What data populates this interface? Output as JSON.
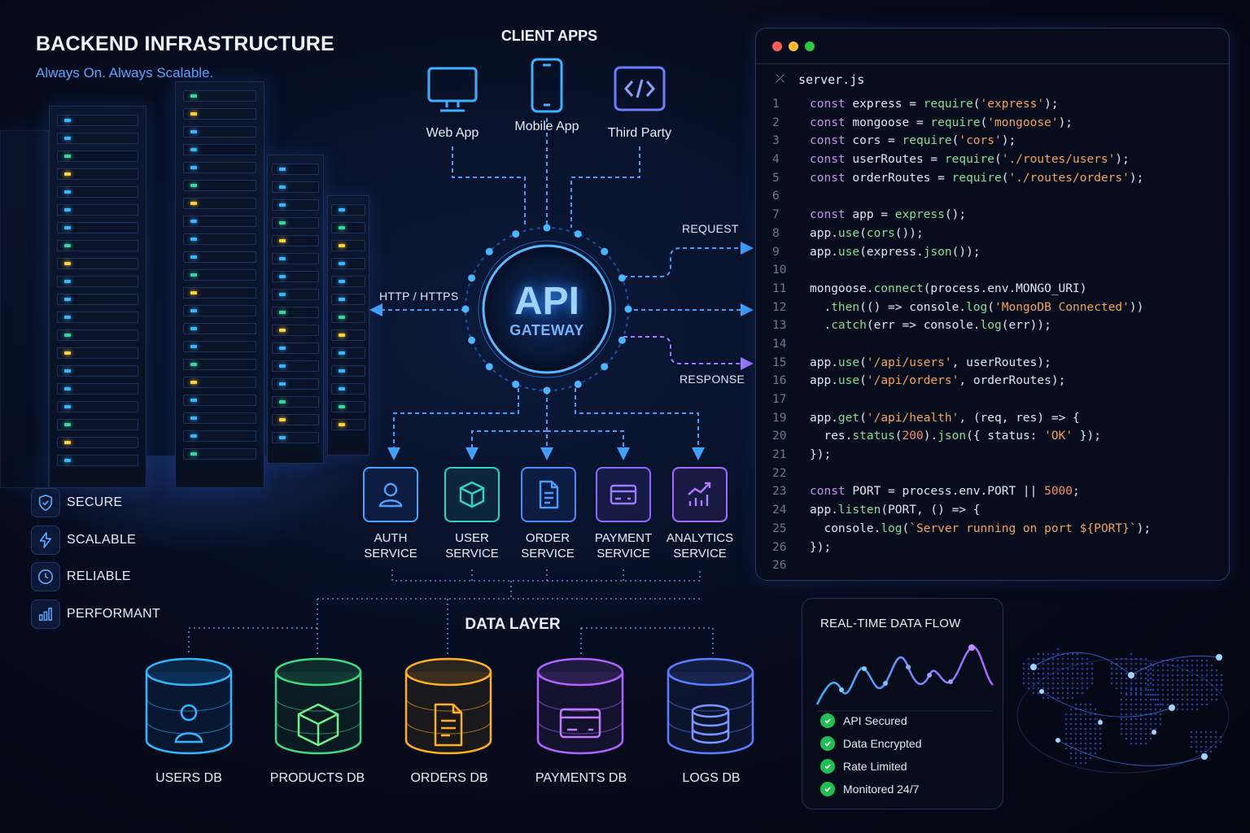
{
  "header": {
    "title": "BACKEND INFRASTRUCTURE",
    "subtitle": "Always On. Always Scalable."
  },
  "features": [
    {
      "label": "SECURE",
      "icon": "shield-icon"
    },
    {
      "label": "SCALABLE",
      "icon": "lightning-icon"
    },
    {
      "label": "RELIABLE",
      "icon": "clock-icon"
    },
    {
      "label": "PERFORMANT",
      "icon": "bar-chart-icon"
    }
  ],
  "clients": {
    "title": "CLIENT APPS",
    "items": [
      {
        "label": "Web App",
        "icon": "monitor-icon"
      },
      {
        "label": "Mobile App",
        "icon": "phone-icon"
      },
      {
        "label": "Third Party",
        "icon": "code-icon"
      }
    ]
  },
  "gateway": {
    "title": "API",
    "subtitle": "GATEWAY",
    "http_label": "HTTP / HTTPS",
    "request_label": "REQUEST",
    "response_label": "RESPONSE"
  },
  "services": [
    {
      "line1": "AUTH",
      "line2": "SERVICE",
      "icon": "user-icon",
      "color": "#4aa3ff"
    },
    {
      "line1": "USER",
      "line2": "SERVICE",
      "icon": "cube-icon",
      "color": "#2fd4c0"
    },
    {
      "line1": "ORDER",
      "line2": "SERVICE",
      "icon": "document-icon",
      "color": "#4a8cff"
    },
    {
      "line1": "PAYMENT",
      "line2": "SERVICE",
      "icon": "card-icon",
      "color": "#8a6bff"
    },
    {
      "line1": "ANALYTICS",
      "line2": "SERVICE",
      "icon": "analytics-icon",
      "color": "#a66bff"
    }
  ],
  "data_layer": {
    "title": "DATA LAYER",
    "dbs": [
      {
        "label": "USERS DB",
        "icon": "user-icon",
        "color": "#2fb8ff"
      },
      {
        "label": "PRODUCTS DB",
        "icon": "box-icon",
        "color": "#3ddc84"
      },
      {
        "label": "ORDERS DB",
        "icon": "document-icon",
        "color": "#ffb020"
      },
      {
        "label": "PAYMENTS DB",
        "icon": "card-icon",
        "color": "#b063ff"
      },
      {
        "label": "LOGS DB",
        "icon": "database-icon",
        "color": "#5b7dff"
      }
    ]
  },
  "code": {
    "filename": "server.js",
    "lines": [
      {
        "n": "1",
        "text": "const express = require('express');"
      },
      {
        "n": "2",
        "text": "const mongoose = require('mongoose');"
      },
      {
        "n": "3",
        "text": "const cors = require('cors');"
      },
      {
        "n": "4",
        "text": "const userRoutes = require('./routes/users');"
      },
      {
        "n": "5",
        "text": "const orderRoutes = require('./routes/orders');"
      },
      {
        "n": "6",
        "text": ""
      },
      {
        "n": "7",
        "text": "const app = express();"
      },
      {
        "n": "8",
        "text": "app.use(cors());"
      },
      {
        "n": "9",
        "text": "app.use(express.json());"
      },
      {
        "n": "10",
        "text": ""
      },
      {
        "n": "11",
        "text": "mongoose.connect(process.env.MONGO_URI)"
      },
      {
        "n": "12",
        "text": "  .then(() => console.log('MongoDB Connected'))"
      },
      {
        "n": "13",
        "text": "  .catch(err => console.log(err));"
      },
      {
        "n": "14",
        "text": ""
      },
      {
        "n": "15",
        "text": "app.use('/api/users', userRoutes);"
      },
      {
        "n": "16",
        "text": "app.use('/api/orders', orderRoutes);"
      },
      {
        "n": "17",
        "text": ""
      },
      {
        "n": "19",
        "text": "app.get('/api/health', (req, res) => {"
      },
      {
        "n": "20",
        "text": "  res.status(200).json({ status: 'OK' });"
      },
      {
        "n": "21",
        "text": "});"
      },
      {
        "n": "22",
        "text": ""
      },
      {
        "n": "23",
        "text": "const PORT = process.env.PORT || 5000;"
      },
      {
        "n": "24",
        "text": "app.listen(PORT, () => {"
      },
      {
        "n": "25",
        "text": "  console.log(`Server running on port ${PORT}`);"
      },
      {
        "n": "26",
        "text": "});"
      },
      {
        "n": "26",
        "text": ""
      }
    ]
  },
  "realtime": {
    "title": "REAL-TIME DATA FLOW",
    "checks": [
      "API Secured",
      "Data Encrypted",
      "Rate Limited",
      "Monitored 24/7"
    ]
  },
  "colors": {
    "accent": "#2f8cff",
    "check": "#1fbf54"
  }
}
